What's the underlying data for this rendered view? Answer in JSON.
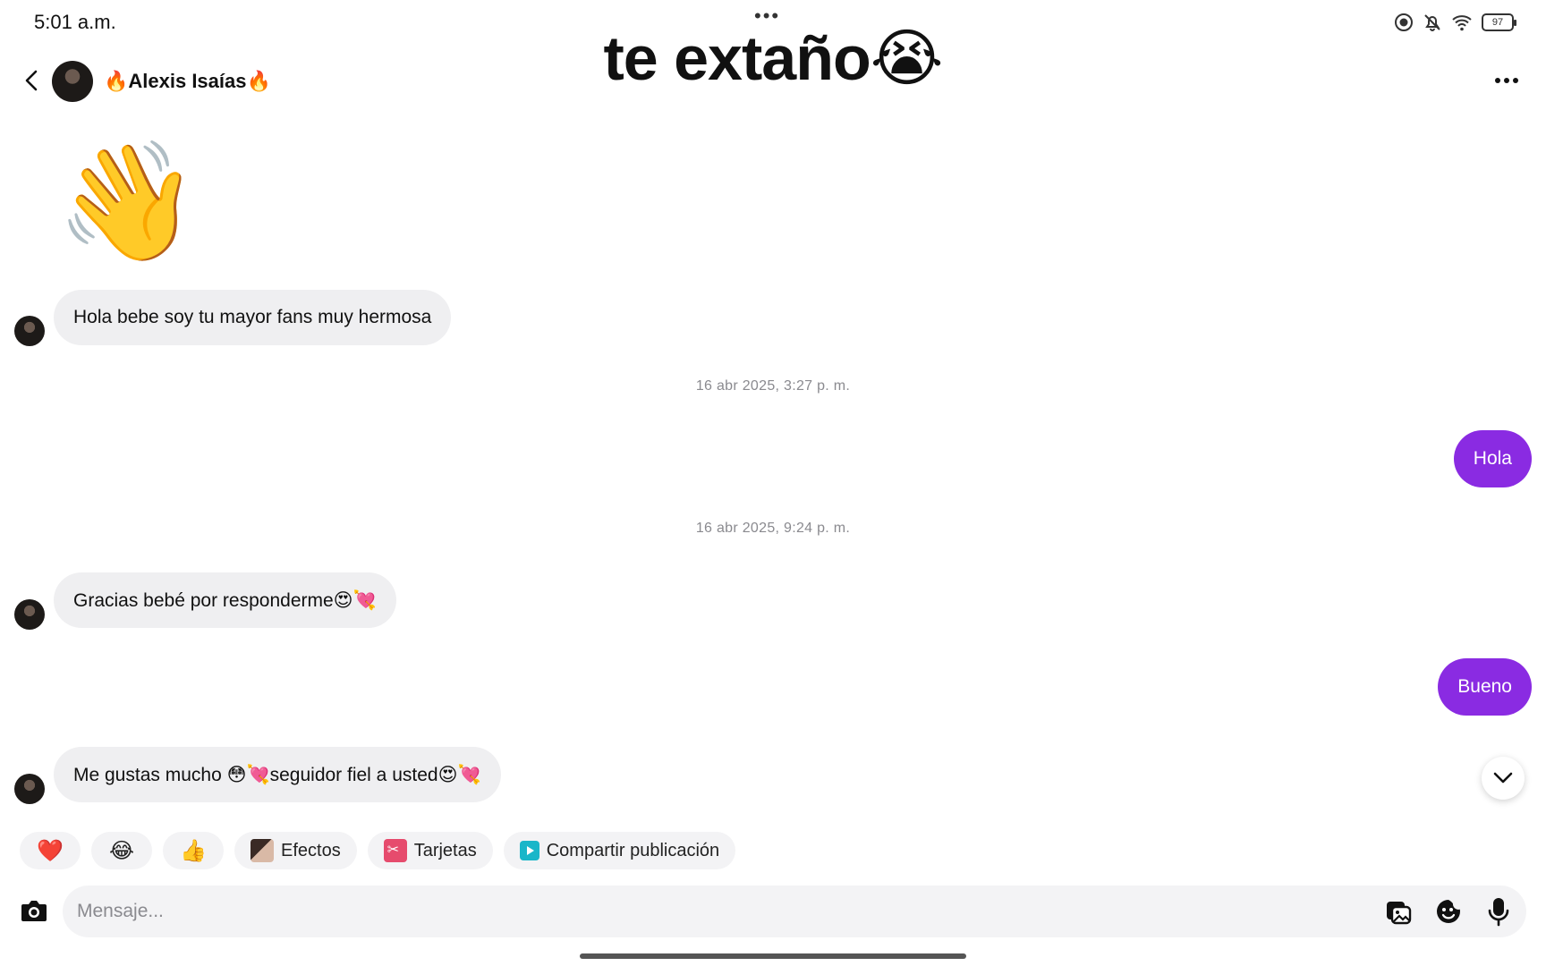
{
  "status_bar": {
    "time": "5:01 a.m.",
    "battery": "97"
  },
  "overlay_caption": "te extaño😭",
  "header": {
    "contact_name": "🔥Alexis Isaías🔥"
  },
  "messages": {
    "sticker": "👋",
    "msg1": "Hola bebe soy tu mayor fans muy hermosa",
    "ts1": "16 abr 2025, 3:27 p. m.",
    "out1": "Hola",
    "ts2": "16 abr 2025, 9:24 p. m.",
    "msg2": "Gracias bebé por responderme😍💘",
    "out2": "Bueno",
    "msg3": "Me gustas mucho 😳💘seguidor fiel a usted😍💘"
  },
  "quick_actions": {
    "heart": "❤️",
    "laugh": "😂",
    "thumbs": "👍",
    "effects": "Efectos",
    "cards": "Tarjetas",
    "share": "Compartir publicación"
  },
  "composer": {
    "placeholder": "Mensaje..."
  },
  "colors": {
    "outgoing_bubble": "#8a2be2",
    "incoming_bubble": "#efeff1"
  }
}
